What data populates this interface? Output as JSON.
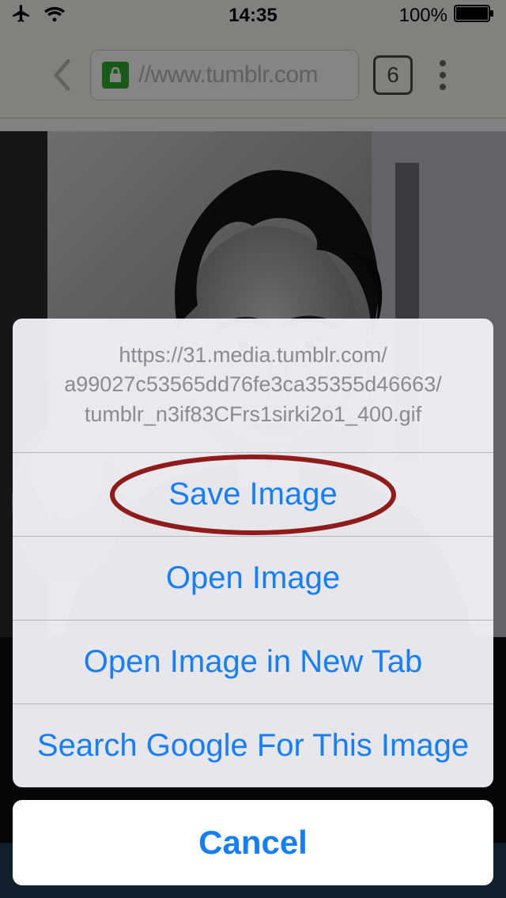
{
  "status_bar": {
    "time": "14:35",
    "battery_pct": "100%"
  },
  "toolbar": {
    "url_display": "//www.tumblr.com",
    "tab_count": "6"
  },
  "action_sheet": {
    "header_line1": "https://31.media.tumblr.com/",
    "header_line2": "a99027c53565dd76fe3ca35355d46663/",
    "header_line3": "tumblr_n3if83CFrs1sirki2o1_400.gif",
    "items": {
      "save_image": "Save Image",
      "open_image": "Open Image",
      "open_new_tab": "Open Image in New Tab",
      "search_google": "Search Google For This Image"
    },
    "cancel": "Cancel"
  }
}
